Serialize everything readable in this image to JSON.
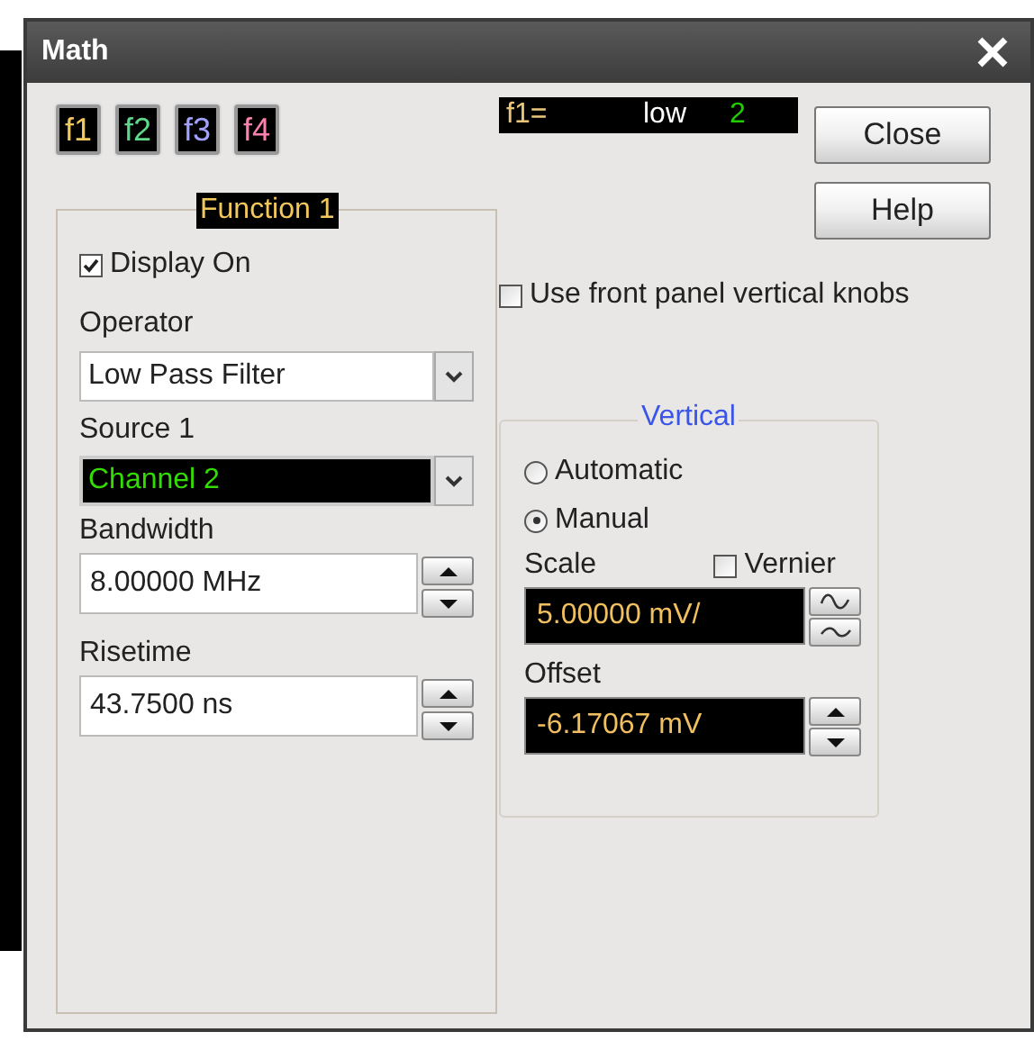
{
  "window": {
    "title": "Math"
  },
  "function_buttons": [
    {
      "label": "f1",
      "color": "#f2c75c"
    },
    {
      "label": "f2",
      "color": "#5fd88c"
    },
    {
      "label": "f3",
      "color": "#a0a0ff"
    },
    {
      "label": "f4",
      "color": "#ff7fae"
    }
  ],
  "status_display": {
    "label": "f1=",
    "operator": "low",
    "source": "2"
  },
  "buttons": [
    "Close",
    "Help"
  ],
  "front_panel_knobs": {
    "label": "Use front panel vertical knobs",
    "checked": false
  },
  "function_group": {
    "title": "Function 1",
    "display_on": {
      "label": "Display On",
      "checked": true
    },
    "operator": {
      "label": "Operator",
      "value": "Low Pass Filter"
    },
    "source": {
      "label": "Source 1",
      "value": "Channel 2"
    },
    "bandwidth": {
      "label": "Bandwidth",
      "value": "8.00000 MHz"
    },
    "risetime": {
      "label": "Risetime",
      "value": "43.7500 ns"
    }
  },
  "vertical": {
    "title": "Vertical",
    "modes": [
      {
        "label": "Automatic",
        "selected": false
      },
      {
        "label": "Manual",
        "selected": true
      }
    ],
    "vernier": {
      "label": "Vernier",
      "checked": false
    },
    "scale": {
      "label": "Scale",
      "value": "5.00000 mV/"
    },
    "offset": {
      "label": "Offset",
      "value": "-6.17067 mV"
    }
  }
}
